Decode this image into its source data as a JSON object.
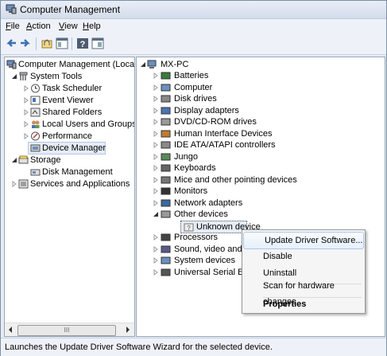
{
  "window": {
    "title": "Computer Management"
  },
  "menubar": [
    {
      "label": "File",
      "u": "F",
      "rest": "ile"
    },
    {
      "label": "Action",
      "u": "A",
      "rest": "ction"
    },
    {
      "label": "View",
      "u": "V",
      "rest": "iew"
    },
    {
      "label": "Help",
      "u": "H",
      "rest": "elp"
    }
  ],
  "toolbar": {
    "icons": [
      "back-arrow-icon",
      "forward-arrow-icon",
      "up-folder-icon",
      "show-hide-tree-icon",
      "help-icon",
      "properties-pane-icon"
    ]
  },
  "left_tree": [
    {
      "label": "Computer Management (Local"
    },
    {
      "label": "System Tools"
    },
    {
      "label": "Task Scheduler"
    },
    {
      "label": "Event Viewer"
    },
    {
      "label": "Shared Folders"
    },
    {
      "label": "Local Users and Groups"
    },
    {
      "label": "Performance"
    },
    {
      "label": "Device Manager"
    },
    {
      "label": "Storage"
    },
    {
      "label": "Disk Management"
    },
    {
      "label": "Services and Applications"
    }
  ],
  "hscroll": {
    "thumb": "III"
  },
  "device_tree": {
    "root": "MX-PC",
    "items": [
      "Batteries",
      "Computer",
      "Disk drives",
      "Display adapters",
      "DVD/CD-ROM drives",
      "Human Interface Devices",
      "IDE ATA/ATAPI controllers",
      "Jungo",
      "Keyboards",
      "Mice and other pointing devices",
      "Monitors",
      "Network adapters",
      "Other devices",
      "Unknown device",
      "Processors",
      "Sound, video and ga",
      "System devices",
      "Universal Serial Bus"
    ]
  },
  "context_menu": {
    "update": "Update Driver Software...",
    "disable": "Disable",
    "uninstall": "Uninstall",
    "scan": "Scan for hardware changes",
    "properties": "Properties"
  },
  "status": {
    "text": "Launches the Update Driver Software Wizard for the selected device."
  }
}
